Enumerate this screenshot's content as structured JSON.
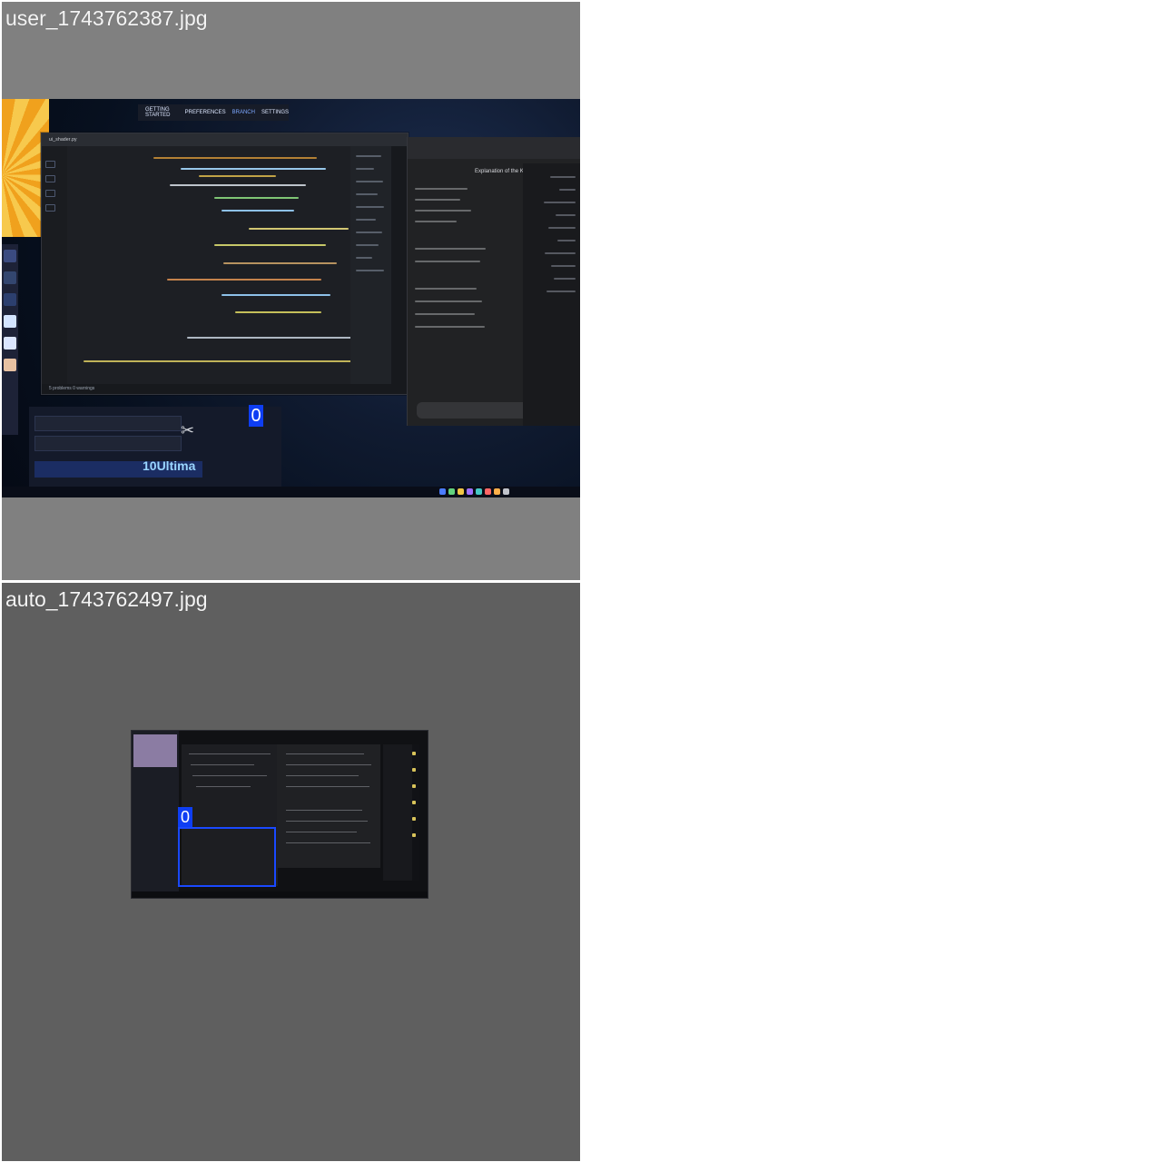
{
  "captions": {
    "top": "user_1743762387.jpg",
    "bottom": "auto_1743762497.jpg"
  },
  "top_screenshot": {
    "selection_label": "0",
    "browser_tabs": [
      "GETTING STARTED",
      "PREFERENCES",
      "BRANCH",
      "SETTINGS"
    ],
    "ide_title": "ui_shader.py",
    "status_bar": "5 problems  0 warnings",
    "chat_title": "Explanation of the Key Cod",
    "promo": "10Ultima"
  },
  "bottom_screenshot": {
    "selection_label": "0"
  },
  "colors": {
    "selection": "#0e3ef3",
    "top_background": "#808080",
    "bottom_background": "#5f5f5f"
  }
}
